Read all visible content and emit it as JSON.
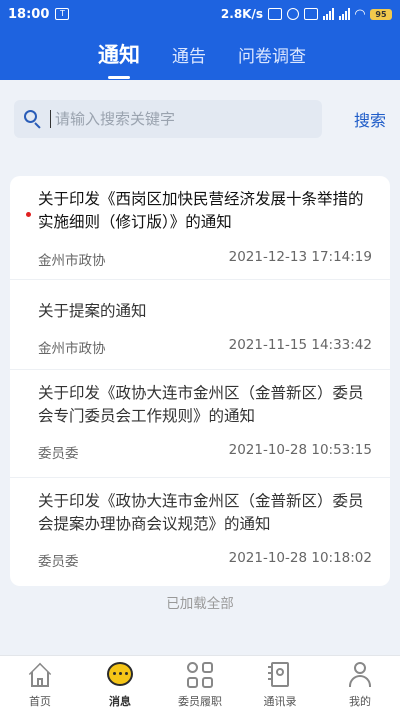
{
  "status_bar": {
    "time": "18:00",
    "notif_icon": "T",
    "network_speed": "2.8K/s",
    "battery": "95"
  },
  "header": {
    "tabs": [
      {
        "label": "通知",
        "active": true
      },
      {
        "label": "通告",
        "active": false
      },
      {
        "label": "问卷调查",
        "active": false
      }
    ]
  },
  "search": {
    "placeholder": "请输入搜索关键字",
    "value": "",
    "button_label": "搜索"
  },
  "notices": [
    {
      "title": "关于印发《西岗区加快民营经济发展十条举措的实施细则（修订版）》的通知",
      "source": "金州市政协",
      "datetime": "2021-12-13 17:14:19",
      "unread": true
    },
    {
      "title": "关于提案的通知",
      "source": "金州市政协",
      "datetime": "2021-11-15 14:33:42",
      "unread": false
    },
    {
      "title": "关于印发《政协大连市金州区（金普新区）委员会专门委员会工作规则》的通知",
      "source": "委员委",
      "datetime": "2021-10-28 10:53:15",
      "unread": false
    },
    {
      "title": "关于印发《政协大连市金州区（金普新区）委员会提案办理协商会议规范》的通知",
      "source": "委员委",
      "datetime": "2021-10-28 10:18:02",
      "unread": false
    }
  ],
  "loaded_all_text": "已加载全部",
  "bottom_nav": [
    {
      "label": "首页",
      "icon": "home-icon"
    },
    {
      "label": "消息",
      "icon": "message-icon",
      "active": true
    },
    {
      "label": "委员履职",
      "icon": "grid-icon"
    },
    {
      "label": "通讯录",
      "icon": "contacts-icon"
    },
    {
      "label": "我的",
      "icon": "profile-icon"
    }
  ],
  "colors": {
    "brand_blue": "#1e63e0",
    "unread_dot": "#e02020",
    "message_icon": "#f5c518"
  }
}
